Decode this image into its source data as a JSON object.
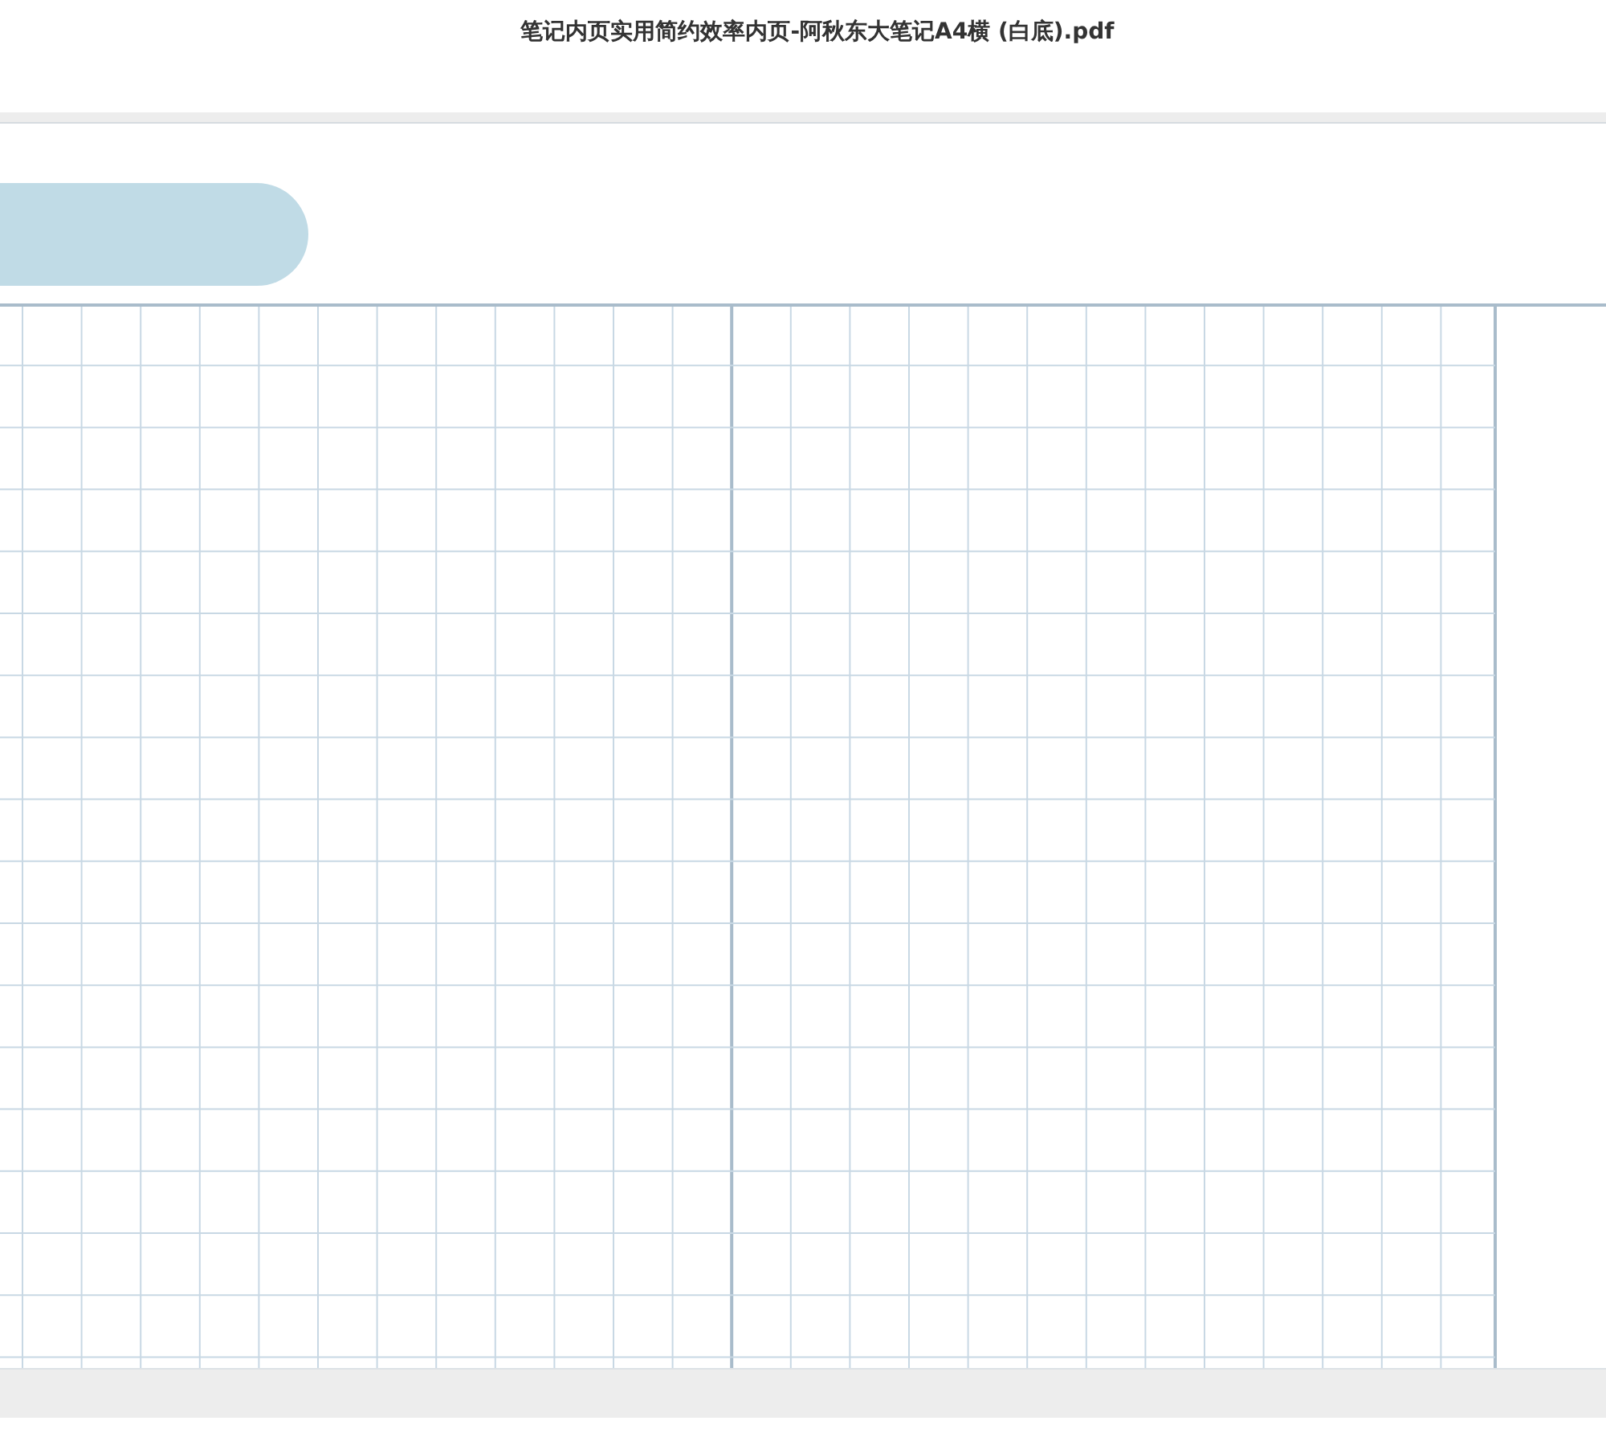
{
  "window": {
    "title": "笔记内页实用简约效率内页-阿秋东大笔记A4横 (白底).pdf"
  }
}
